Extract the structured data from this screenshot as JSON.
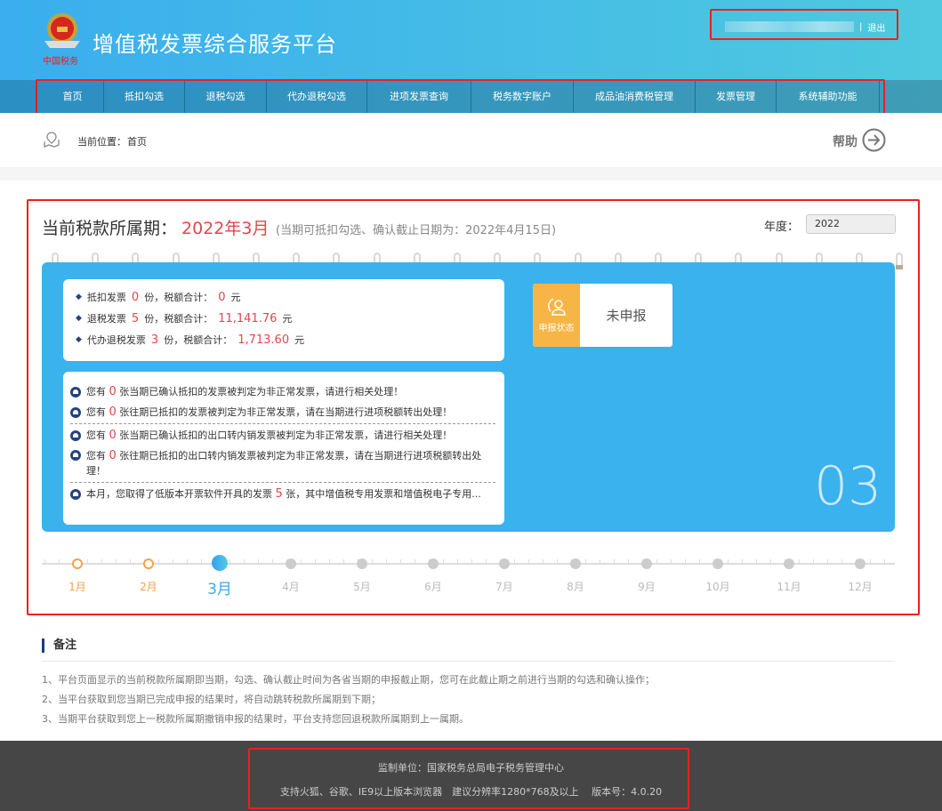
{
  "header": {
    "title": "增值税发票综合服务平台",
    "logo_text": "中国税务",
    "logout": "退出",
    "separator": "|"
  },
  "nav": [
    "首页",
    "抵扣勾选",
    "退税勾选",
    "代办退税勾选",
    "进项发票查询",
    "税务数字账户",
    "成品油消费税管理",
    "发票管理",
    "系统辅助功能"
  ],
  "breadcrumb": {
    "label": "当前位置：",
    "current": "首页",
    "help": "帮助"
  },
  "period": {
    "label": "当前税款所属期：",
    "value": "2022年3月",
    "note": "(当期可抵扣勾选、确认截止日期为：2022年4月15日)",
    "year_label": "年度：",
    "year_value": "2022"
  },
  "summary": [
    {
      "prefix": "抵扣发票",
      "count": "0",
      "mid": "份，税额合计：",
      "amount": "0",
      "unit": "元"
    },
    {
      "prefix": "退税发票",
      "count": "5",
      "mid": "份，税额合计：",
      "amount": "11,141.76",
      "unit": "元"
    },
    {
      "prefix": "代办退税发票",
      "count": "3",
      "mid": "份，税额合计：",
      "amount": "1,713.60",
      "unit": "元"
    }
  ],
  "status": {
    "label": "申报状态",
    "value": "未申报"
  },
  "alerts": [
    {
      "pre": "您有",
      "count": "0",
      "text": "张当期已确认抵扣的发票被判定为非正常发票，请进行相关处理！"
    },
    {
      "pre": "您有",
      "count": "0",
      "text": "张往期已抵扣的发票被判定为非正常发票，请在当期进行进项税额转出处理！"
    },
    {
      "pre": "您有",
      "count": "0",
      "text": "张当期已确认抵扣的出口转内销发票被判定为非正常发票，请进行相关处理！"
    },
    {
      "pre": "您有",
      "count": "0",
      "text": "张往期已抵扣的出口转内销发票被判定为非正常发票，请在当期进行进项税额转出处理！"
    },
    {
      "pre": "本月，您取得了低版本开票软件开具的发票",
      "count": "5",
      "text": "张，其中增值税专用发票和增值税电子专用..."
    }
  ],
  "big_month": "03",
  "timeline": {
    "months": [
      "1月",
      "2月",
      "3月",
      "4月",
      "5月",
      "6月",
      "7月",
      "8月",
      "9月",
      "10月",
      "11月",
      "12月"
    ],
    "current_index": 2,
    "colors": {
      "past": "#f5a04c",
      "current": "#38aaee",
      "future": "#cccccc"
    }
  },
  "notes": {
    "title": "备注",
    "items": [
      "1、平台页面显示的当前税款所属期即当期，勾选、确认截止时间为各省当期的申报截止期，您可在此截止期之前进行当期的勾选和确认操作；",
      "2、当平台获取到您当期已完成申报的结果时，将自动跳转税款所属期到下期；",
      "3、当期平台获取到您上一税款所属期撤销申报的结果时，平台支持您回退税款所属期到上一属期。"
    ]
  },
  "footer": {
    "line1": "监制单位：国家税务总局电子税务管理中心",
    "line2": "支持火狐、谷歌、IE9以上版本浏览器　建议分辨率1280*768及以上　 版本号：4.0.20"
  }
}
